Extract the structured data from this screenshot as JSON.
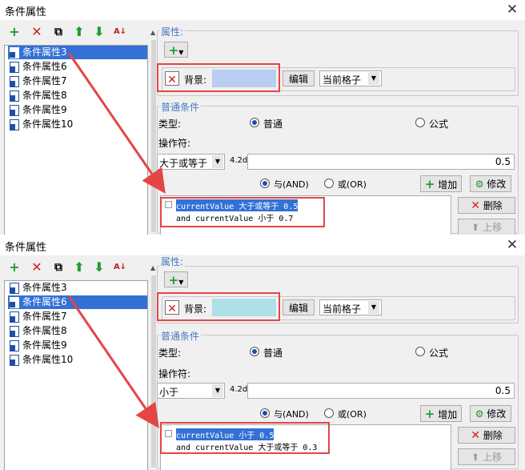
{
  "window_title": "条件属性",
  "icons": {
    "add": "plus-icon",
    "delete": "x-icon",
    "copy": "copy-icon",
    "move_up": "arrow-up-icon",
    "move_down": "arrow-down-icon",
    "sort": "sort-az-icon",
    "close": "close-icon"
  },
  "colors": {
    "selection": "#3371d6",
    "annotation_red": "#e54545",
    "background_swatch_top": "#b9cdf0",
    "background_swatch_bottom": "#aee0e6"
  },
  "panels": [
    {
      "list_items": [
        "条件属性3",
        "条件属性6",
        "条件属性7",
        "条件属性8",
        "条件属性9",
        "条件属性10"
      ],
      "selected_index": 0,
      "attributes_label": "属性:",
      "background_label": "背景:",
      "edit_button": "编辑",
      "scope_select": "当前格子",
      "normal_group": "普通条件",
      "type_label": "类型:",
      "radio_normal": "普通",
      "radio_formula": "公式",
      "operator_label": "操作符:",
      "operator_value": "大于或等于",
      "format": "4.2d",
      "value": "0.5",
      "and_label": "与(AND)",
      "or_label": "或(OR)",
      "add_button": "增加",
      "modify_button": "修改",
      "delete_button": "删除",
      "moveup_button": "上移",
      "conditions": [
        "currentValue 大于或等于 0.5",
        "and currentValue 小于 0.7"
      ]
    },
    {
      "list_items": [
        "条件属性3",
        "条件属性6",
        "条件属性7",
        "条件属性8",
        "条件属性9",
        "条件属性10"
      ],
      "selected_index": 1,
      "attributes_label": "属性:",
      "background_label": "背景:",
      "edit_button": "编辑",
      "scope_select": "当前格子",
      "normal_group": "普通条件",
      "type_label": "类型:",
      "radio_normal": "普通",
      "radio_formula": "公式",
      "operator_label": "操作符:",
      "operator_value": "小于",
      "format": "4.2d",
      "value": "0.5",
      "and_label": "与(AND)",
      "or_label": "或(OR)",
      "add_button": "增加",
      "modify_button": "修改",
      "delete_button": "删除",
      "moveup_button": "上移",
      "conditions": [
        "currentValue 小于 0.5",
        "and currentValue 大于或等于 0.3"
      ]
    }
  ]
}
